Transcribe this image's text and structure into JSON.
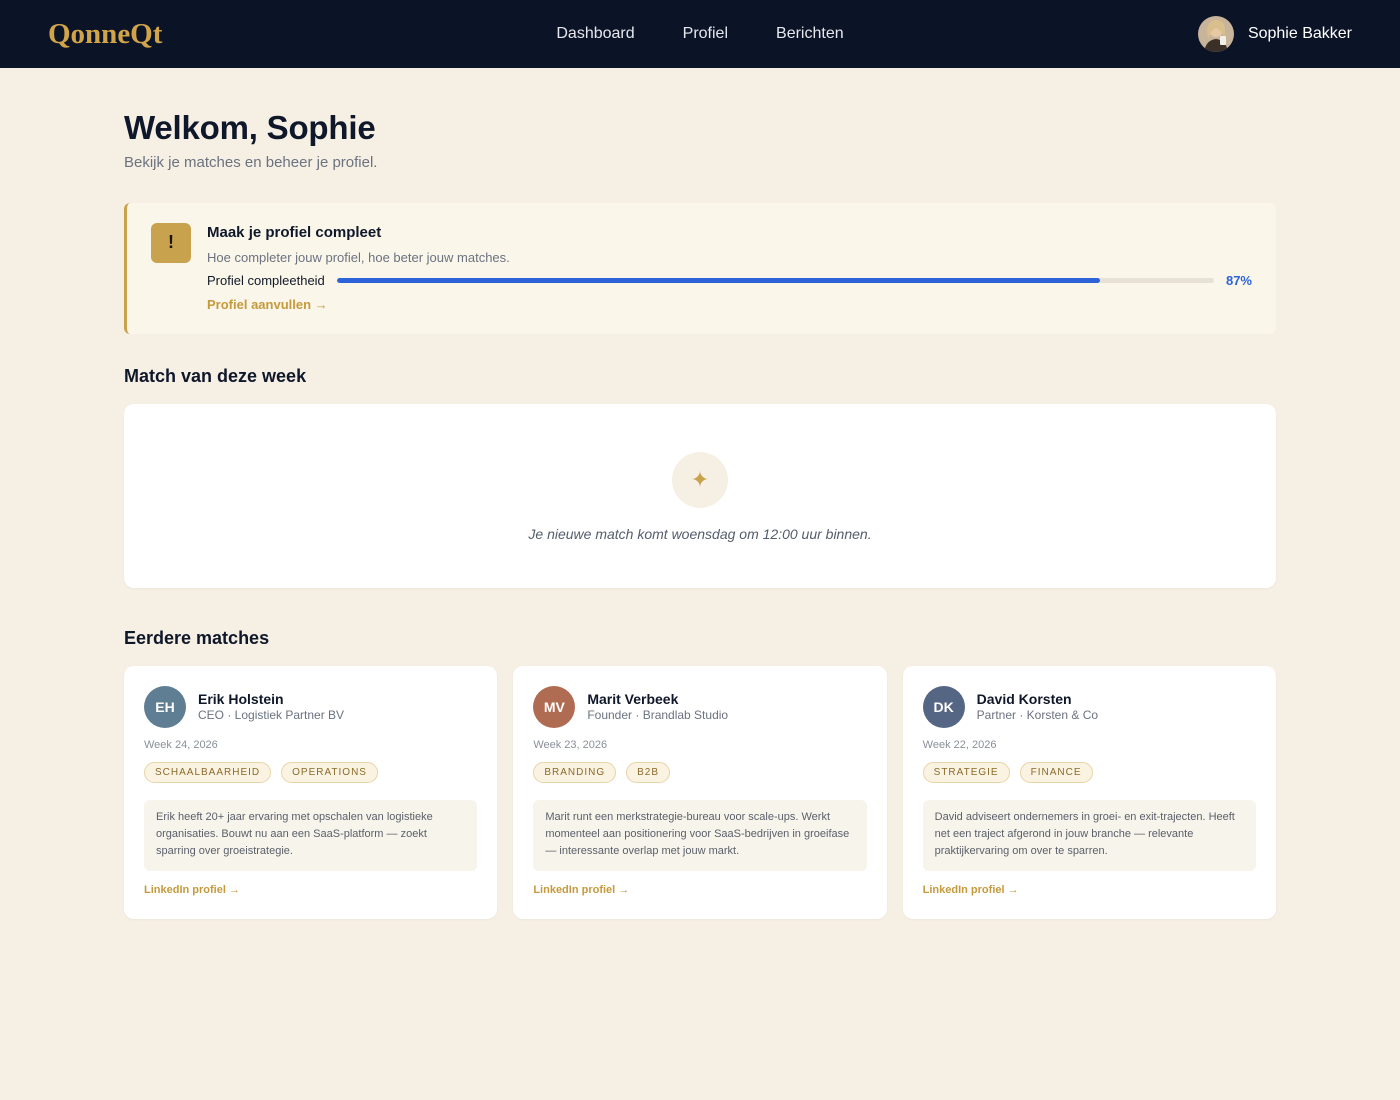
{
  "app": {
    "logo": "QonneQt"
  },
  "nav": {
    "items": [
      {
        "label": "Dashboard"
      },
      {
        "label": "Profiel"
      },
      {
        "label": "Berichten"
      }
    ]
  },
  "user": {
    "name": "Sophie Bakker"
  },
  "header": {
    "title": "Welkom, Sophie",
    "subtitle": "Bekijk je matches en beheer je profiel."
  },
  "profile_completion": {
    "badge": "!",
    "title": "Maak je profiel compleet",
    "subtitle": "Hoe completer jouw profiel, hoe beter jouw matches.",
    "progress_label": "Profiel compleetheid",
    "percent_value": 87,
    "percent_text": "87%",
    "link": "Profiel aanvullen →",
    "colors": {
      "accent": "#c9a24d",
      "progress": "#2c63d8"
    }
  },
  "week_match": {
    "title": "Match van deze week",
    "icon": "sparkle-icon",
    "message": "Je nieuwe match komt woensdag om 12:00 uur binnen."
  },
  "earlier": {
    "title": "Eerdere matches",
    "matches": [
      {
        "initials": "EH",
        "avatar_color": "#5f7d93",
        "name": "Erik Holstein",
        "role": "CEO · Logistiek Partner BV",
        "week": "Week 24, 2026",
        "tags": [
          "Schaalbaarheid",
          "Operations"
        ],
        "description": "Erik heeft 20+ jaar ervaring met opschalen van logistieke organisaties. Bouwt nu aan een SaaS-platform — zoekt sparring over groeistrategie.",
        "link": "LinkedIn profiel →"
      },
      {
        "initials": "MV",
        "avatar_color": "#b06c52",
        "name": "Marit Verbeek",
        "role": "Founder · Brandlab Studio",
        "week": "Week 23, 2026",
        "tags": [
          "Branding",
          "B2B"
        ],
        "description": "Marit runt een merkstrategie-bureau voor scale-ups. Werkt momenteel aan positionering voor SaaS-bedrijven in groeifase — interessante overlap met jouw markt.",
        "link": "LinkedIn profiel →"
      },
      {
        "initials": "DK",
        "avatar_color": "#556684",
        "name": "David Korsten",
        "role": "Partner · Korsten & Co",
        "week": "Week 22, 2026",
        "tags": [
          "Strategie",
          "Finance"
        ],
        "description": "David adviseert ondernemers in groei- en exit-trajecten. Heeft net een traject afgerond in jouw branche — relevante praktijkervaring om over te sparren.",
        "link": "LinkedIn profiel →"
      }
    ]
  }
}
